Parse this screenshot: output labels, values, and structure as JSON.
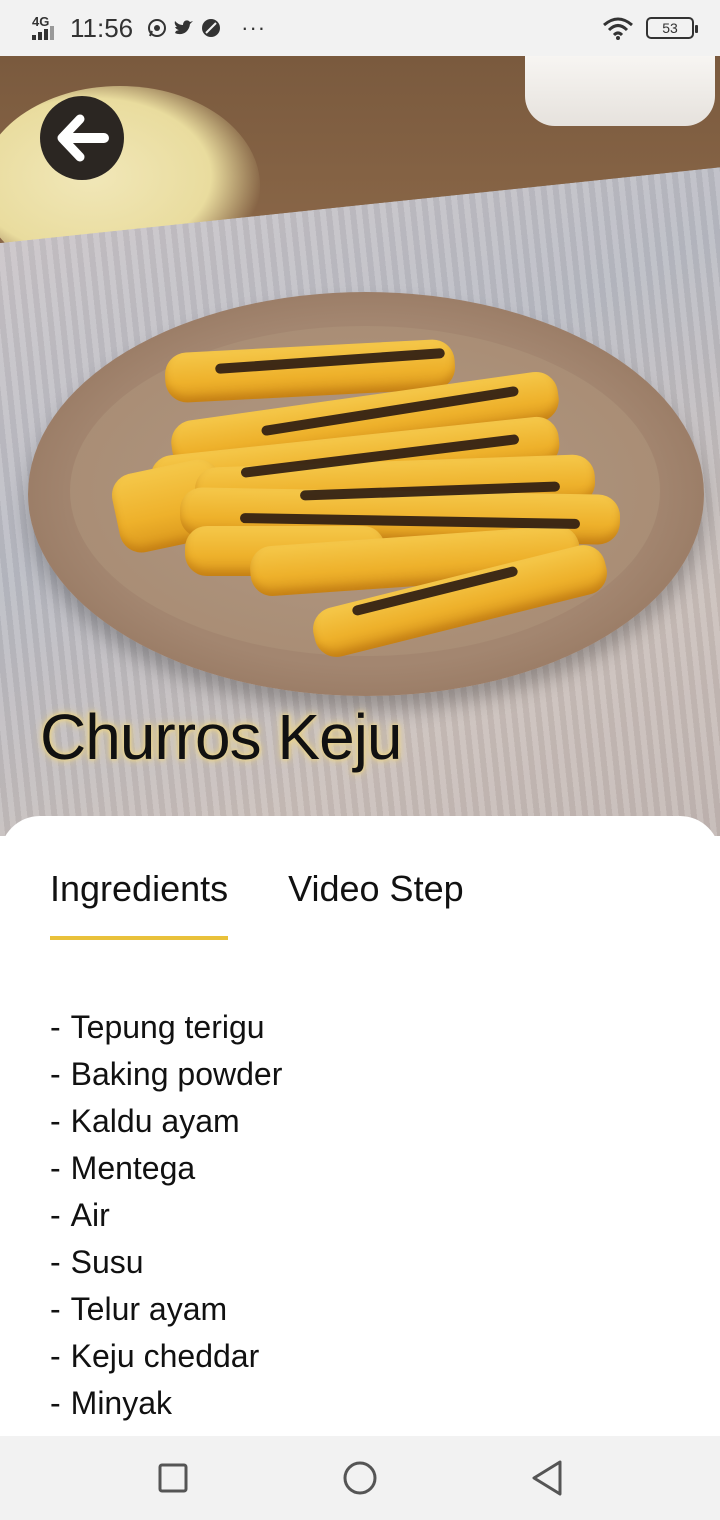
{
  "status_bar": {
    "network": "4G",
    "time": "11:56",
    "notification_icons": [
      "whatsapp-icon",
      "twitter-icon",
      "leaf-icon"
    ],
    "more": "···",
    "battery": "53"
  },
  "recipe": {
    "title": "Churros Keju"
  },
  "tabs": [
    {
      "label": "Ingredients",
      "active": true
    },
    {
      "label": "Video Step",
      "active": false
    }
  ],
  "ingredients": [
    "Tepung terigu",
    "Baking powder",
    "Kaldu ayam",
    "Mentega",
    "Air",
    "Susu",
    "Telur ayam",
    "Keju cheddar",
    "Minyak"
  ],
  "ingredient_prefix": "-",
  "colors": {
    "accent": "#e9c13a",
    "back_button_bg": "#2b2622",
    "status_bar_bg": "#f2f2f2"
  }
}
